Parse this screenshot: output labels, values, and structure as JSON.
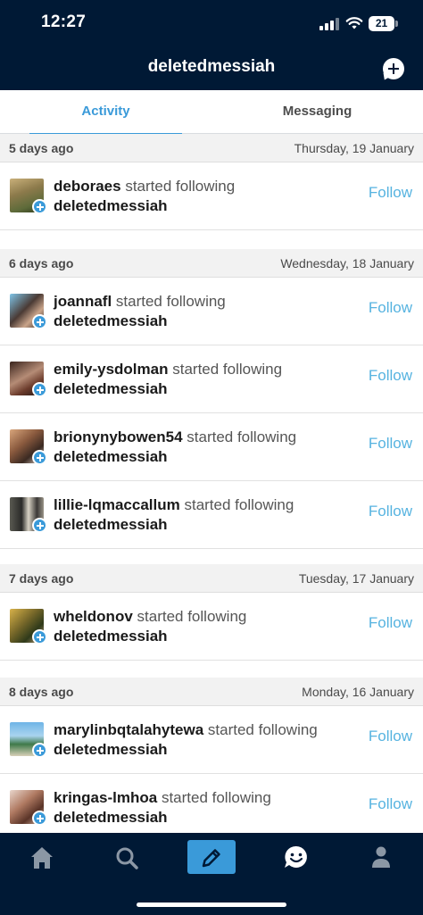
{
  "status_bar": {
    "time": "12:27",
    "battery": "21"
  },
  "header": {
    "title": "deletedmessiah"
  },
  "tabs": [
    {
      "label": "Activity",
      "active": true
    },
    {
      "label": "Messaging",
      "active": false
    }
  ],
  "sections": [
    {
      "ago": "5 days ago",
      "date": "Thursday, 19 January",
      "items": [
        {
          "username": "deboraes",
          "action": "started following",
          "target": "deletedmessiah",
          "button": "Follow"
        }
      ]
    },
    {
      "ago": "6 days ago",
      "date": "Wednesday, 18 January",
      "items": [
        {
          "username": "joannafl",
          "action": "started following",
          "target": "deletedmessiah",
          "button": "Follow"
        },
        {
          "username": "emily-ysdolman",
          "action": "started following",
          "target": "deletedmessiah",
          "button": "Follow"
        },
        {
          "username": "brionynybowen54",
          "action": "started following",
          "target": "deletedmessiah",
          "button": "Follow"
        },
        {
          "username": "lillie-lqmaccallum",
          "action": "started following",
          "target": "deletedmessiah",
          "button": "Follow"
        }
      ]
    },
    {
      "ago": "7 days ago",
      "date": "Tuesday, 17 January",
      "items": [
        {
          "username": "wheldonov",
          "action": "started following",
          "target": "deletedmessiah",
          "button": "Follow"
        }
      ]
    },
    {
      "ago": "8 days ago",
      "date": "Monday, 16 January",
      "items": [
        {
          "username": "marylinbqtalahytewa",
          "action": "started following",
          "target": "deletedmessiah",
          "button": "Follow"
        },
        {
          "username": "kringas-lmhoa",
          "action": "started following",
          "target": "deletedmessiah",
          "button": "Follow"
        }
      ]
    }
  ],
  "bottom_nav": [
    {
      "icon": "home-icon"
    },
    {
      "icon": "search-icon"
    },
    {
      "icon": "pencil-icon"
    },
    {
      "icon": "chat-smiley-icon"
    },
    {
      "icon": "person-icon"
    }
  ],
  "colors": {
    "header_bg": "#001935",
    "accent": "#3a9ad9",
    "follow": "#56b3e0"
  }
}
